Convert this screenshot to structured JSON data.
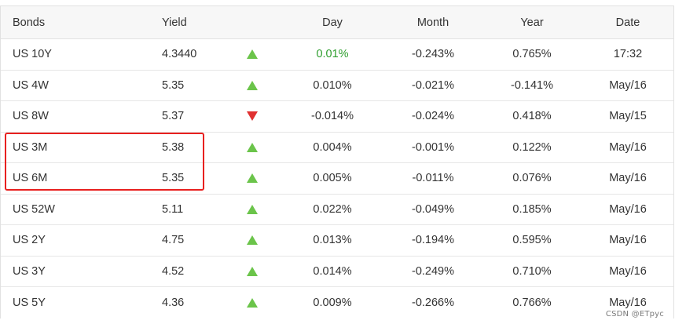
{
  "table": {
    "headers": {
      "bonds": "Bonds",
      "yield": "Yield",
      "day": "Day",
      "month": "Month",
      "year": "Year",
      "date": "Date"
    },
    "rows": [
      {
        "name": "US 10Y",
        "yield": "4.3440",
        "direction": "up",
        "day": "0.01%",
        "month": "-0.243%",
        "year": "0.765%",
        "date": "17:32"
      },
      {
        "name": "US 4W",
        "yield": "5.35",
        "direction": "up",
        "day": "0.010%",
        "month": "-0.021%",
        "year": "-0.141%",
        "date": "May/16"
      },
      {
        "name": "US 8W",
        "yield": "5.37",
        "direction": "down",
        "day": "-0.014%",
        "month": "-0.024%",
        "year": "0.418%",
        "date": "May/15"
      },
      {
        "name": "US 3M",
        "yield": "5.38",
        "direction": "up",
        "day": "0.004%",
        "month": "-0.001%",
        "year": "0.122%",
        "date": "May/16"
      },
      {
        "name": "US 6M",
        "yield": "5.35",
        "direction": "up",
        "day": "0.005%",
        "month": "-0.011%",
        "year": "0.076%",
        "date": "May/16"
      },
      {
        "name": "US 52W",
        "yield": "5.11",
        "direction": "up",
        "day": "0.022%",
        "month": "-0.049%",
        "year": "0.185%",
        "date": "May/16"
      },
      {
        "name": "US 2Y",
        "yield": "4.75",
        "direction": "up",
        "day": "0.013%",
        "month": "-0.194%",
        "year": "0.595%",
        "date": "May/16"
      },
      {
        "name": "US 3Y",
        "yield": "4.52",
        "direction": "up",
        "day": "0.014%",
        "month": "-0.249%",
        "year": "0.710%",
        "date": "May/16"
      },
      {
        "name": "US 5Y",
        "yield": "4.36",
        "direction": "up",
        "day": "0.009%",
        "month": "-0.266%",
        "year": "0.766%",
        "date": "May/16"
      }
    ]
  },
  "highlight": {
    "color": "#e8201f"
  },
  "colors": {
    "up_arrow": "#6bc44a",
    "down_arrow": "#e03131",
    "positive_day_text": "#2e9e2e",
    "header_background": "#f7f7f7"
  },
  "icons": {
    "up": "triangle-up-icon",
    "down": "triangle-down-icon"
  },
  "watermark": "CSDN @ETpyc"
}
